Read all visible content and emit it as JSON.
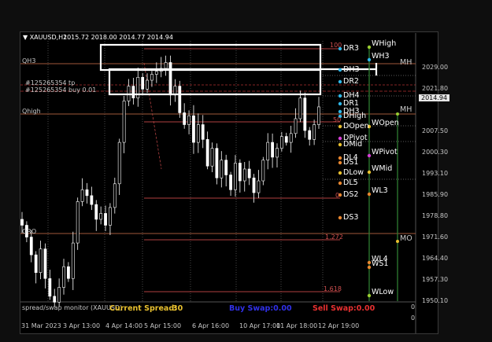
{
  "chart_header": {
    "symbol": "▼ XAUUSD,H1",
    "ohlc": "2015.72 2018.00 2014.77 2014.94"
  },
  "left_labels": {
    "qh3": "QH3",
    "order_tp": "#125265354 tp",
    "order_buy": "#125265354 buy 0.01",
    "qhigh": "Qhigh",
    "qrow": "QRO"
  },
  "fib_labels": {
    "f100": "100",
    "f50": "50",
    "f0": "0",
    "f1272": "1.272",
    "f1618": "1.618"
  },
  "daily_pivots": [
    {
      "label": "DR3",
      "color": "#2fb7e8"
    },
    {
      "label": "DH3",
      "color": "#2fb7e8"
    },
    {
      "label": "DR2",
      "color": "#2fb7e8"
    },
    {
      "label": "DH4",
      "color": "#2fb7e8"
    },
    {
      "label": "DR1",
      "color": "#2fb7e8"
    },
    {
      "label": "DH3",
      "color": "#2fb7e8"
    },
    {
      "label": "DHigh",
      "color": "#2fb7e8"
    },
    {
      "label": "DOpen",
      "color": "#e8c02f"
    },
    {
      "label": "DPivot",
      "color": "#d63fd6"
    },
    {
      "label": "DMid",
      "color": "#e8c02f"
    },
    {
      "label": "DL4",
      "color": "#e8862f"
    },
    {
      "label": "DS1",
      "color": "#e8862f"
    },
    {
      "label": "DLow",
      "color": "#e8c02f"
    },
    {
      "label": "DL5",
      "color": "#e8862f"
    },
    {
      "label": "DS2",
      "color": "#e8862f"
    },
    {
      "label": "DS3",
      "color": "#e8862f"
    }
  ],
  "weekly_pivots": [
    {
      "label": "WHigh",
      "color": "#9acd32"
    },
    {
      "label": "WH3",
      "color": "#2fb7e8"
    },
    {
      "label": "WOpen",
      "color": "#e8c02f"
    },
    {
      "label": "WPivot",
      "color": "#d63fd6"
    },
    {
      "label": "WMid",
      "color": "#e8c02f"
    },
    {
      "label": "WL3",
      "color": "#e8862f"
    },
    {
      "label": "WL4",
      "color": "#e8862f"
    },
    {
      "label": "WS1",
      "color": "#e8862f"
    },
    {
      "label": "WLow",
      "color": "#9acd32"
    }
  ],
  "monthly_pivots": [
    {
      "label": "MH"
    },
    {
      "label": "MH"
    },
    {
      "label": "MO"
    }
  ],
  "price_axis": {
    "ticks": [
      "2029.00",
      "2021.80",
      "2007.50",
      "2000.30",
      "1993.10",
      "1985.90",
      "1978.80",
      "1971.60",
      "1964.40",
      "1957.30",
      "1950.10"
    ],
    "current_price": "2014.94",
    "indicator_ticks": [
      "0",
      "0"
    ]
  },
  "time_axis": {
    "ticks": [
      "31 Mar 2023",
      "3 Apr 13:00",
      "4 Apr 14:00",
      "5 Apr 15:00",
      "6 Apr 16:00",
      "10 Apr 17:00",
      "11 Apr 18:00",
      "12 Apr 19:00"
    ]
  },
  "indicator": {
    "title": "spread/swap monitor (XAUUSD)",
    "spread_label": "Current Spread:",
    "spread_value": "30",
    "buy_label": "Buy Swap:",
    "buy_value": "0.00",
    "sell_label": "Sell Swap:",
    "sell_value": "0.00",
    "colors": {
      "spread": "#e8c02f",
      "buy": "#3030e8",
      "sell": "#e83030"
    }
  },
  "chart_data": {
    "type": "candlestick",
    "symbol": "XAUUSD",
    "timeframe": "H1",
    "last": {
      "open": 2015.72,
      "high": 2018.0,
      "low": 2014.77,
      "close": 2014.94
    },
    "y_ticks": [
      2029.0,
      2021.8,
      2007.5,
      2000.3,
      1993.1,
      1985.9,
      1978.8,
      1971.6,
      1964.4,
      1957.3,
      1950.1
    ],
    "ylim": [
      1948.5,
      2037.5
    ],
    "x_ticks": [
      "31 Mar 2023",
      "3 Apr 13:00",
      "4 Apr 14:00",
      "5 Apr 15:00",
      "6 Apr 16:00",
      "10 Apr 17:00",
      "11 Apr 18:00",
      "12 Apr 19:00"
    ],
    "close_path": [
      1976,
      1972,
      1966,
      1960,
      1968,
      1958,
      1952,
      1950,
      1955,
      1962,
      1958,
      1970,
      1984,
      1988,
      1986,
      1983,
      1978,
      1980,
      1976,
      1982,
      1990,
      2004,
      2018,
      2023,
      2019,
      2026,
      2022,
      2025,
      2027,
      2028,
      2029,
      2031,
      2020,
      2023,
      2014,
      2010,
      2013,
      2004,
      2010,
      2005,
      1996,
      2002,
      1992,
      1998,
      1993,
      1988,
      1997,
      1991,
      1995,
      1992,
      1987,
      1991,
      1998,
      2004,
      1999,
      2002,
      2006,
      2004,
      2007,
      2012,
      2019,
      2008,
      2005,
      2010,
      2016
    ]
  }
}
